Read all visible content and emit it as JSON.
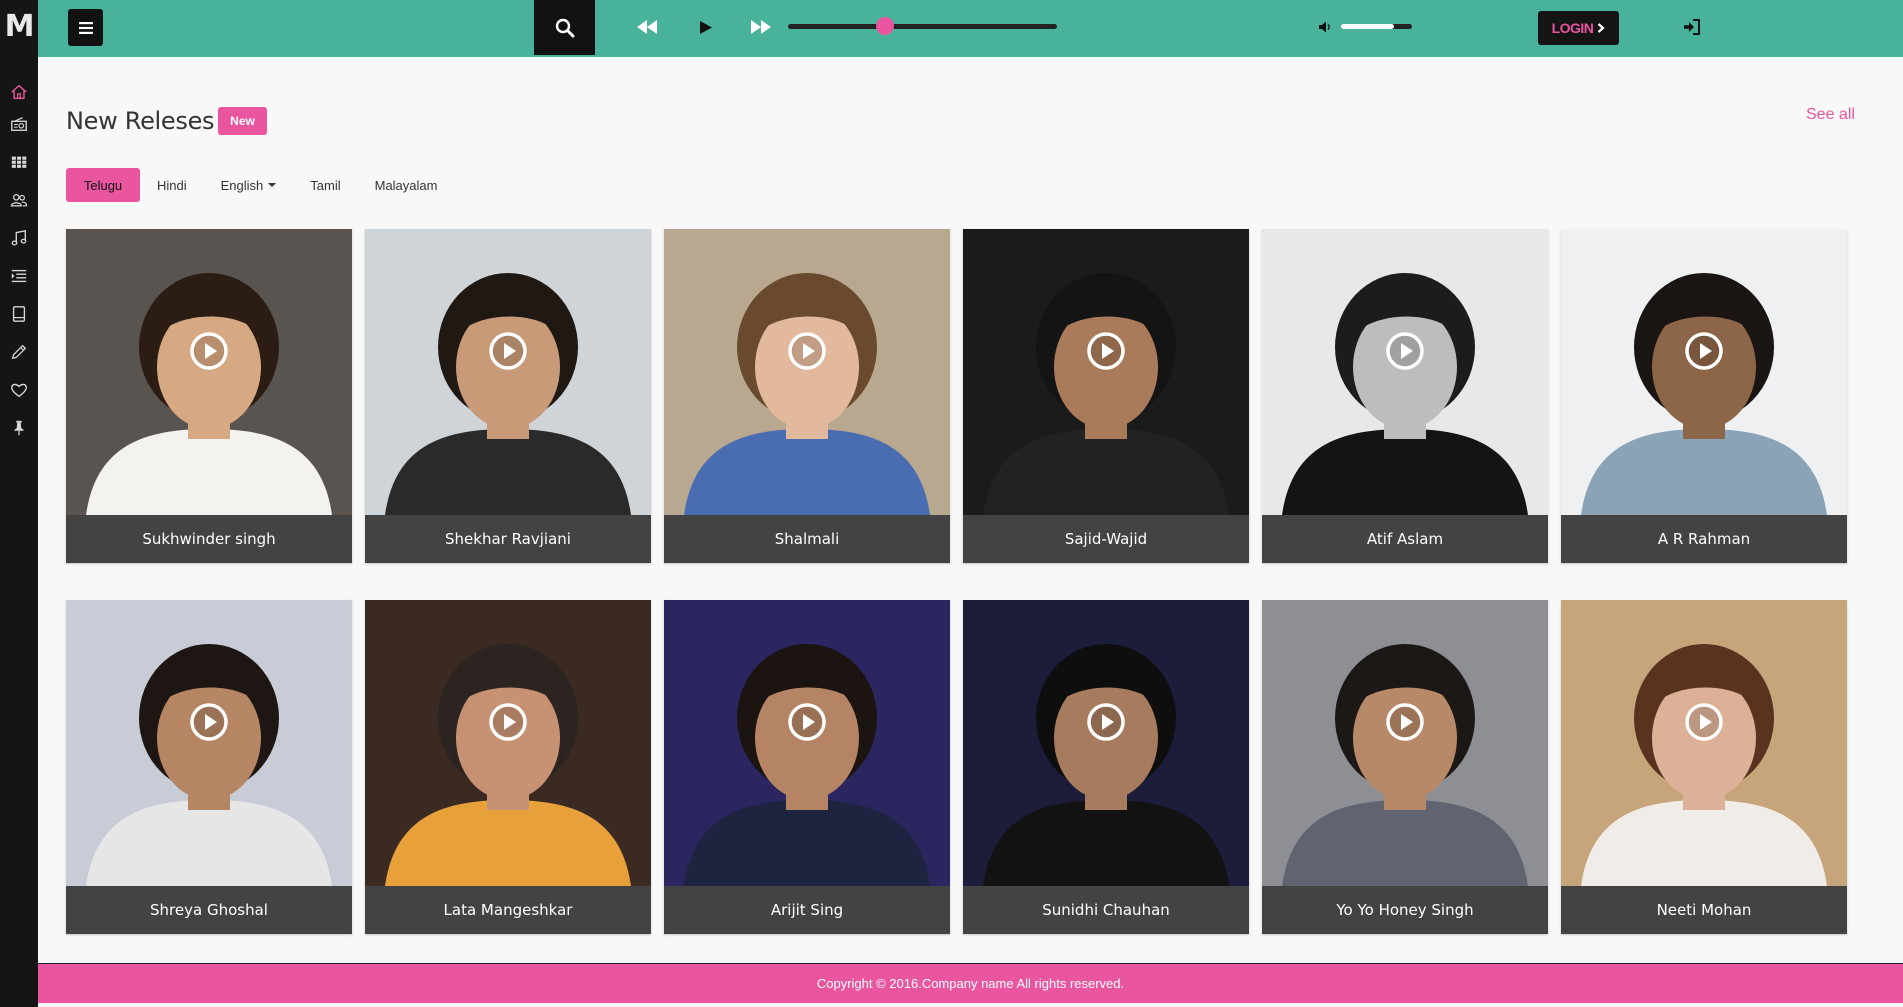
{
  "app": {
    "logo": "M"
  },
  "sidebar": {
    "items": [
      {
        "icon": "home-icon",
        "active": true
      },
      {
        "icon": "radio-icon"
      },
      {
        "icon": "grid-icon"
      },
      {
        "icon": "users-icon"
      },
      {
        "icon": "music-note-icon"
      },
      {
        "icon": "playlist-icon"
      },
      {
        "icon": "book-icon"
      },
      {
        "icon": "pencil-icon"
      },
      {
        "icon": "heart-icon"
      },
      {
        "icon": "pin-icon"
      }
    ]
  },
  "player": {
    "progress": 0.36,
    "volume": 0.75
  },
  "header": {
    "login_label": "LOGIN"
  },
  "section": {
    "title": "New Releses",
    "badge": "New",
    "see_all": "See all"
  },
  "tabs": [
    {
      "label": "Telugu",
      "active": true
    },
    {
      "label": "Hindi"
    },
    {
      "label": "English",
      "dropdown": true
    },
    {
      "label": "Tamil"
    },
    {
      "label": "Malayalam"
    }
  ],
  "artists": [
    {
      "name": "Sukhwinder singh",
      "bg": "#5a5450",
      "skin": "#d7a983",
      "hair": "#2b1d14",
      "shirt": "#f4f2ef"
    },
    {
      "name": "Shekhar Ravjiani",
      "bg": "#cfd4d8",
      "skin": "#c99a78",
      "hair": "#1f1813",
      "shirt": "#2a2a2a"
    },
    {
      "name": "Shalmali",
      "bg": "#b9a890",
      "skin": "#e2b99c",
      "hair": "#6a4a2e",
      "shirt": "#4a6cb0"
    },
    {
      "name": "Sajid-Wajid",
      "bg": "#1b1b1b",
      "skin": "#a97b5a",
      "hair": "#141414",
      "shirt": "#222"
    },
    {
      "name": "Atif Aslam",
      "bg": "#e8e8e8",
      "skin": "#bdbdbd",
      "hair": "#1c1c1c",
      "shirt": "#141414"
    },
    {
      "name": "A R Rahman",
      "bg": "#eef0f1",
      "skin": "#8d6548",
      "hair": "#1a1412",
      "shirt": "#8aa3b7"
    },
    {
      "name": "Shreya Ghoshal",
      "bg": "#c8ccd6",
      "skin": "#b68664",
      "hair": "#1e1612",
      "shirt": "#e6e6e6"
    },
    {
      "name": "Lata Mangeshkar",
      "bg": "#3b2a22",
      "skin": "#c79274",
      "hair": "#2c2420",
      "shirt": "#e8a13a"
    },
    {
      "name": "Arijit Sing",
      "bg": "#2b2560",
      "skin": "#b58464",
      "hair": "#1c1410",
      "shirt": "#1e2340"
    },
    {
      "name": "Sunidhi Chauhan",
      "bg": "#1c1d3a",
      "skin": "#a67b5e",
      "hair": "#0e0e0e",
      "shirt": "#121212"
    },
    {
      "name": "Yo Yo Honey Singh",
      "bg": "#8d8f95",
      "skin": "#b78968",
      "hair": "#1c1816",
      "shirt": "#5f6470"
    },
    {
      "name": "Neeti Mohan",
      "bg": "#c7a57b",
      "skin": "#dcb198",
      "hair": "#5a3320",
      "shirt": "#f0ede8"
    }
  ],
  "footer": {
    "copyright": "Copyright © 2016.Company name All rights reserved."
  },
  "colors": {
    "accent": "#e9559f",
    "topbar": "#48b29a",
    "sidebar": "#151515"
  }
}
